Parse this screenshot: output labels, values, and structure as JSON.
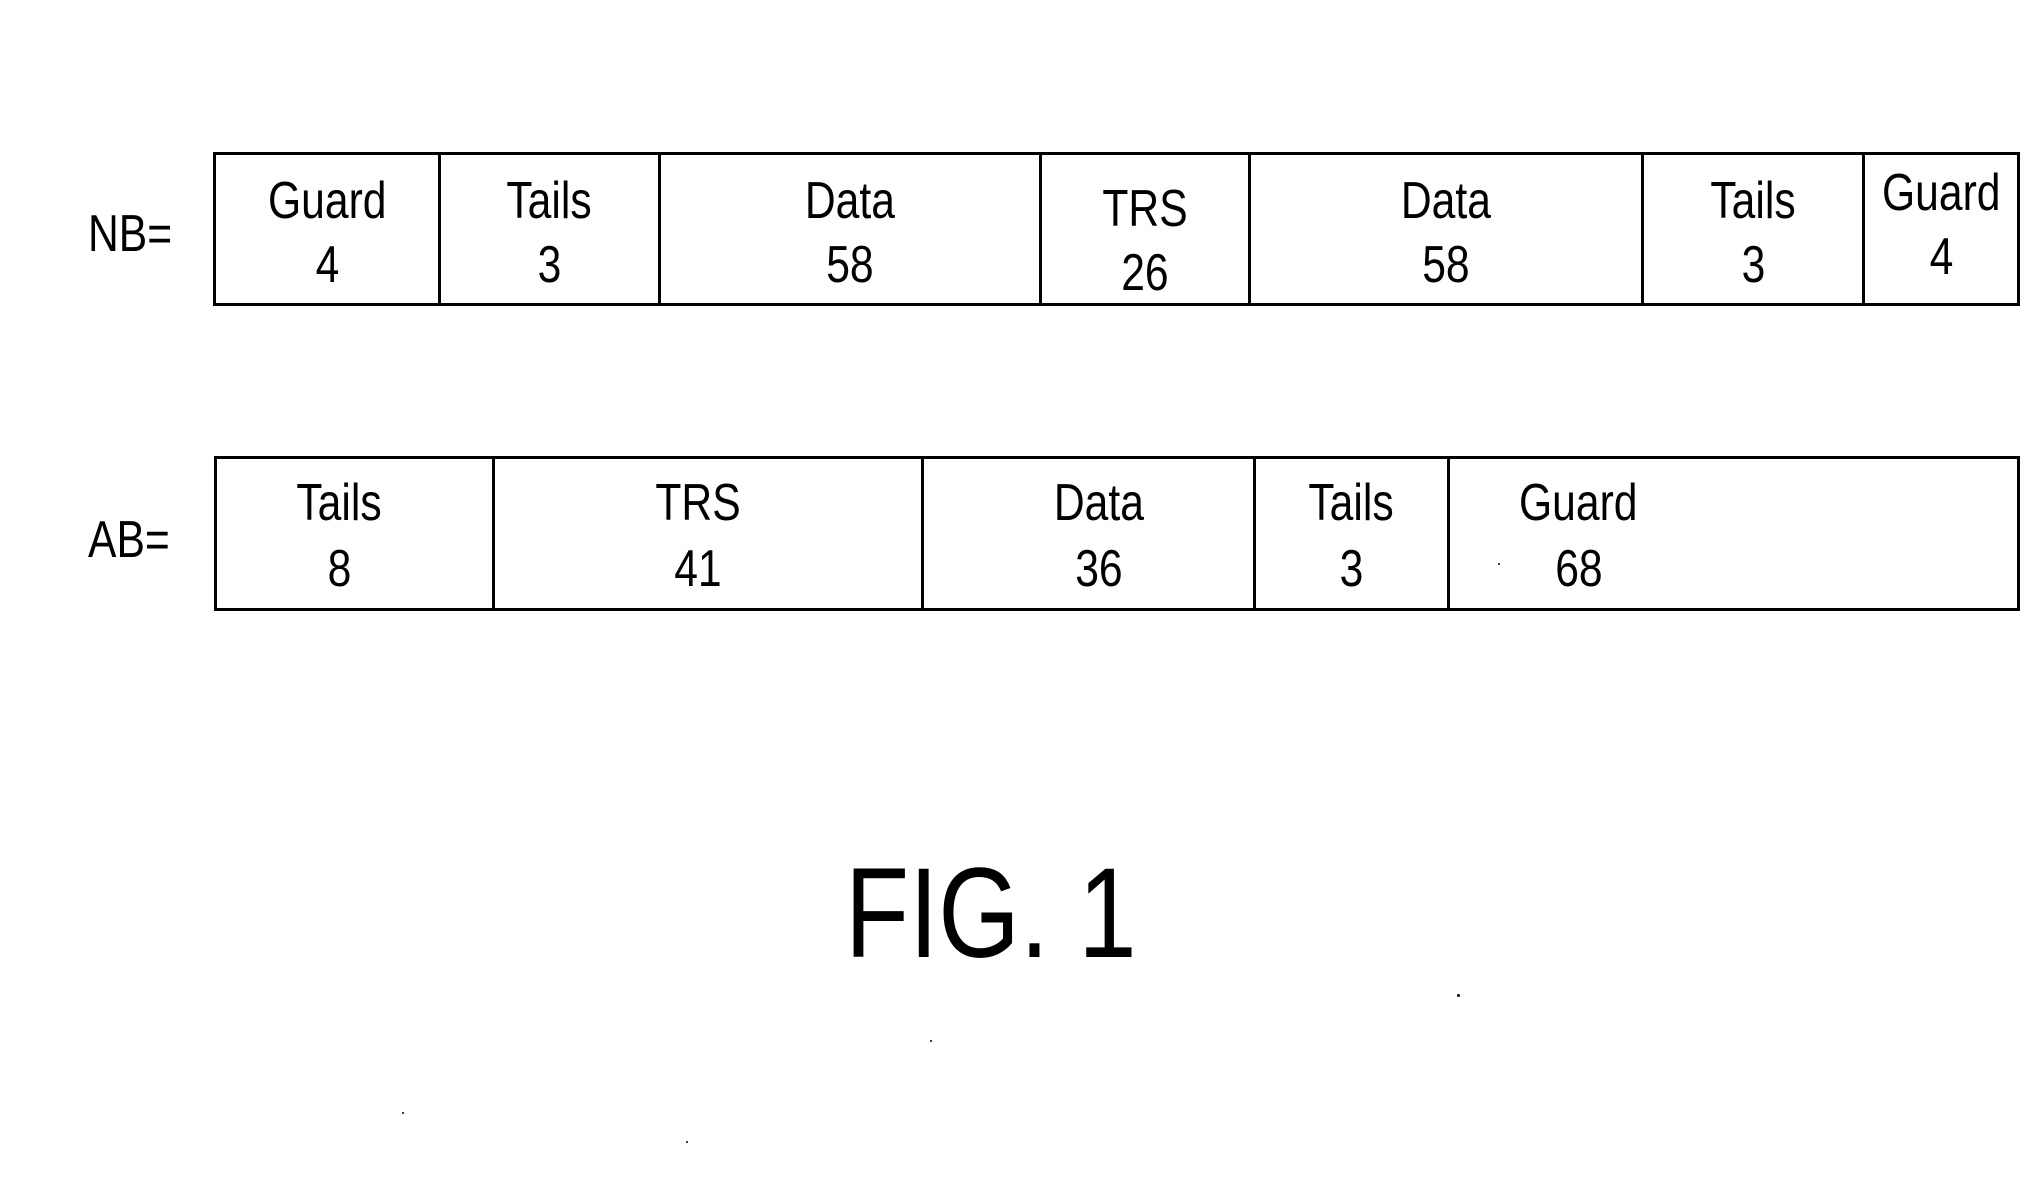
{
  "figure_caption": "FIG. 1",
  "bursts": [
    {
      "label": "NB=",
      "fields": [
        {
          "name": "Guard",
          "value": "4"
        },
        {
          "name": "Tails",
          "value": "3"
        },
        {
          "name": "Data",
          "value": "58"
        },
        {
          "name": "TRS",
          "value": "26"
        },
        {
          "name": "Data",
          "value": "58"
        },
        {
          "name": "Tails",
          "value": "3"
        },
        {
          "name": "Guard",
          "value": "4"
        }
      ]
    },
    {
      "label": "AB=",
      "fields": [
        {
          "name": "Tails",
          "value": "8"
        },
        {
          "name": "TRS",
          "value": "41"
        },
        {
          "name": "Data",
          "value": "36"
        },
        {
          "name": "Tails",
          "value": "3"
        },
        {
          "name": "Guard",
          "value": "68"
        }
      ]
    }
  ]
}
